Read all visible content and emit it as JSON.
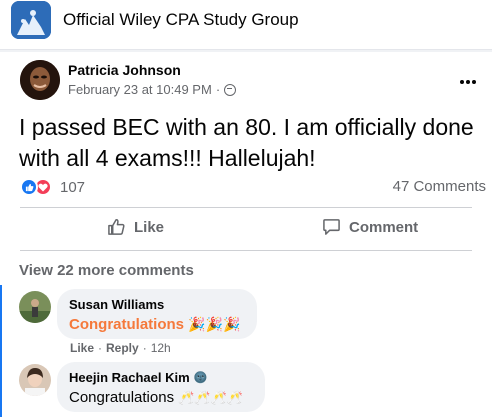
{
  "group": {
    "name": "Official Wiley CPA Study Group"
  },
  "post": {
    "author": "Patricia Johnson",
    "timestamp": "February 23 at 10:49 PM",
    "separator": "·",
    "more_icon": "more-dots-icon",
    "text": "I passed BEC with an 80. I am officially done with all 4 exams!!! Hallelujah!",
    "reaction_count": "107",
    "comment_count": "47 Comments"
  },
  "actions": {
    "like_label": "Like",
    "comment_label": "Comment"
  },
  "comments_section": {
    "view_more_label": "View 22 more comments",
    "comments": [
      {
        "name": "Susan Williams",
        "text": "Congratulations",
        "emoji": "🎉🎉🎉",
        "actions": {
          "like": "Like",
          "sep": "·",
          "reply": "Reply",
          "time": "12h"
        }
      },
      {
        "name": "Heejin Rachael Kim",
        "badge_emoji": "🌚",
        "text": "Congratulations",
        "emoji": "🥂🥂🥂🥂"
      }
    ]
  },
  "colors": {
    "accent": "#1877f2",
    "love": "#f33e58",
    "secondary_text": "#65676b",
    "highlight": "#f5793b"
  }
}
